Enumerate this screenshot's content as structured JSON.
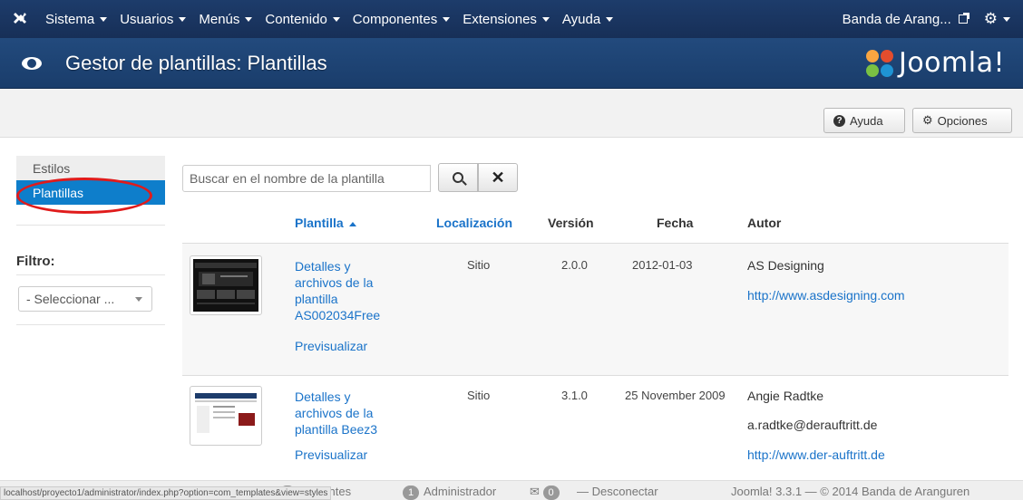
{
  "navbar": {
    "menu": [
      "Sistema",
      "Usuarios",
      "Menús",
      "Contenido",
      "Componentes",
      "Extensiones",
      "Ayuda"
    ],
    "site_link": "Banda de Arang..."
  },
  "header": {
    "title": "Gestor de plantillas: Plantillas",
    "brand": "Joomla!",
    "brand_colors": [
      "#f9a541",
      "#e44d2e",
      "#7ac143",
      "#1f94d4"
    ]
  },
  "toolbar": {
    "help_label": "Ayuda",
    "options_label": "Opciones"
  },
  "sidebar": {
    "items": [
      {
        "label": "Estilos",
        "active": false
      },
      {
        "label": "Plantillas",
        "active": true
      }
    ],
    "filter_label": "Filtro:",
    "select_value": "- Seleccionar ..."
  },
  "search": {
    "placeholder": "Buscar en el nombre de la plantilla"
  },
  "table": {
    "headers": [
      "Plantilla",
      "Localización",
      "Versión",
      "Fecha",
      "Autor"
    ],
    "rows": [
      {
        "name_lines": [
          "Detalles y",
          "archivos de la",
          "plantilla",
          "AS002034Free"
        ],
        "preview": "Previsualizar",
        "location": "Sitio",
        "version": "2.0.0",
        "date": "2012-01-03",
        "author": "AS Designing",
        "author_email": "",
        "author_url": "http://www.asdesigning.com"
      },
      {
        "name_lines": [
          "Detalles y",
          "archivos de la",
          "plantilla Beez3"
        ],
        "preview": "Previsualizar",
        "location": "Sitio",
        "version": "3.1.0",
        "date": "25 November 2009",
        "author": "Angie Radtke",
        "author_email": "a.radtke@derauftritt.de",
        "author_url": "http://www.der-auftritt.de"
      }
    ]
  },
  "status": {
    "url": "localhost/proyecto1/administrator/index.php?option=com_templates&view=styles",
    "visitors_count": "0",
    "visitors_label": "Visitantes",
    "admin_count": "1",
    "admin_label": "Administrador",
    "messages_count": "0",
    "logout_label": "Desconectar",
    "footer": "Joomla! 3.3.1 — © 2014 Banda de Aranguren"
  },
  "colors": {
    "navbar": "#1d3c6b",
    "header": "#224a7d",
    "accent": "#0e7ecb",
    "link": "#1a73c9",
    "annotation": "#e01b1b"
  }
}
